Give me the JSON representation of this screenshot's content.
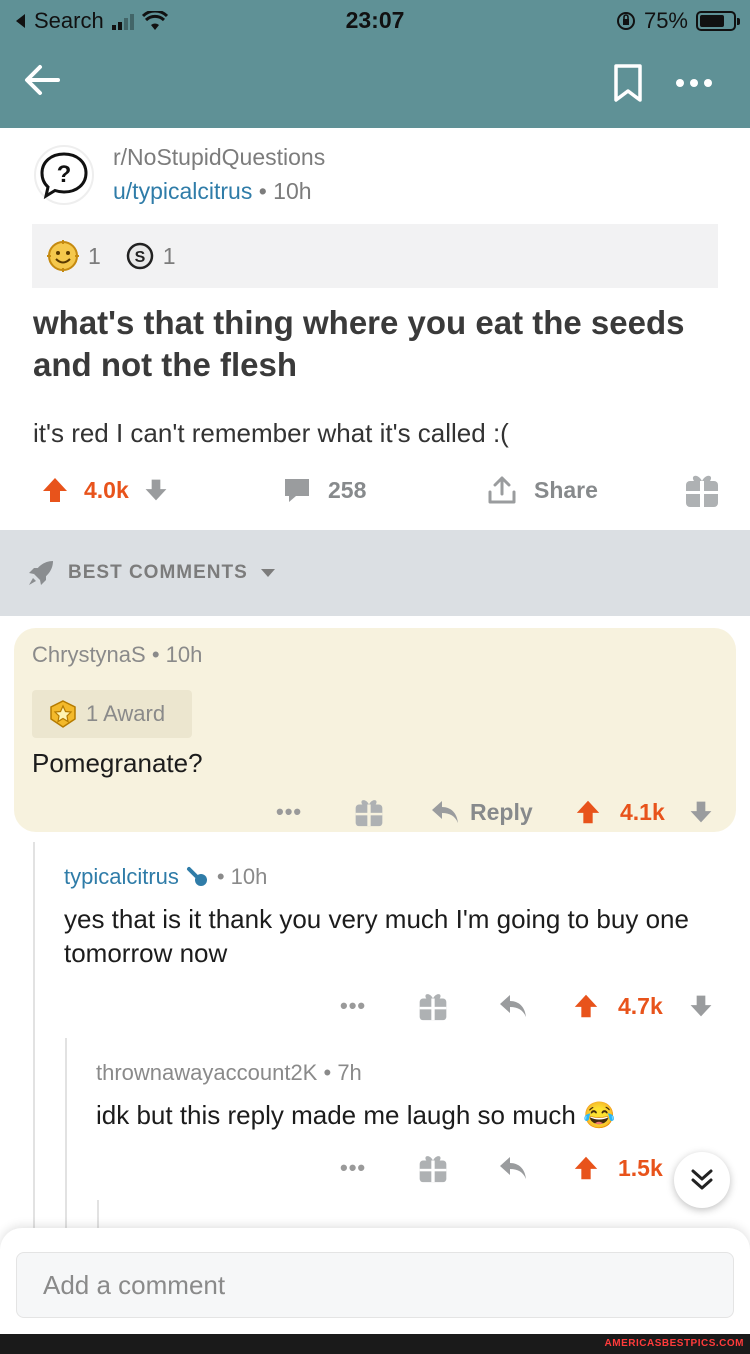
{
  "status_bar": {
    "back_app": "Search",
    "time": "23:07",
    "battery": "75%",
    "battery_level": 0.75
  },
  "colors": {
    "nav_bar": "#5f9196",
    "upvote": "#e8531b",
    "username": "#2f7ca8",
    "highlight_comment": "#f7f2de"
  },
  "nav": {
    "back_icon": "arrow-left-icon",
    "save_icon": "bookmark-icon",
    "more_icon": "more-horizontal-icon"
  },
  "post": {
    "subreddit": "r/NoStupidQuestions",
    "author": "u/typicalcitrus",
    "separator": "•",
    "age": "10h",
    "awards": [
      {
        "icon": "wholesome-award-icon",
        "count": "1"
      },
      {
        "icon": "silver-award-icon",
        "count": "1"
      }
    ],
    "title": "what's that thing where you eat the seeds and not the flesh",
    "body": "it's red I can't remember what it's called :(",
    "score": "4.0k",
    "comments": "258",
    "share_label": "Share"
  },
  "sort": {
    "label": "BEST COMMENTS"
  },
  "comments": [
    {
      "author": "ChrystynaS",
      "separator": "•",
      "age": "10h",
      "award_label": "1 Award",
      "text": "Pomegranate?",
      "more": "•••",
      "reply_label": "Reply",
      "score": "4.1k"
    },
    {
      "author": "typicalcitrus",
      "separator": "•",
      "age": "10h",
      "text": "yes that is it thank you very much I'm going to buy one tomorrow now",
      "more": "•••",
      "score": "4.7k"
    },
    {
      "author": "thrownawayaccount2K",
      "separator": "•",
      "age": "7h",
      "text": "idk but this reply made me laugh so much",
      "emoji": "😂",
      "more": "•••",
      "score": "1.5k"
    }
  ],
  "composer": {
    "placeholder": "Add a comment"
  },
  "footer": {
    "watermark": "AMERICASBESTPICS.COM"
  }
}
